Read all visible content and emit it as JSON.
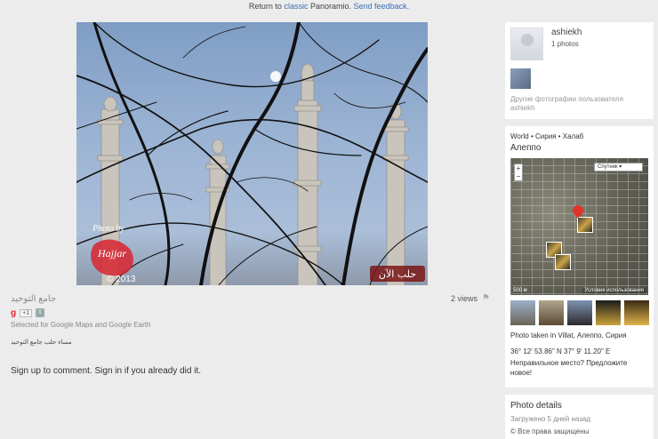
{
  "topbar": {
    "prefix": "Return to",
    "classic_link": "classic",
    "middle": "Panoramio.",
    "feedback_link": "Send feedback."
  },
  "photo": {
    "watermark_line1": "Photo by",
    "watermark_line2": "Hajjar",
    "watermark_year": "© 2013",
    "overlay_text": "حلب الآن"
  },
  "photo_title": "جامع التوحيد",
  "views": "2 views",
  "selected_text": "Selected for Google Maps and Google Earth",
  "description": "مساء حلب جامع التوحيد",
  "signup_text": "Sign up to comment. Sign in if you already did it.",
  "user": {
    "name": "ashiekh",
    "photo_count": "1 photos",
    "other_photos_line1": "Другие фотографии пользователя",
    "other_photos_line2": "ashiekh"
  },
  "location": {
    "breadcrumb": "World • Сирия • Халаб",
    "city": "Алеппо",
    "map_type": "Спутник",
    "map_scale": "500 м",
    "map_terms": "Условия использования",
    "map_zoom_in": "+",
    "map_zoom_out": "−",
    "taken_in": "Photo taken in Villat, Алеппо, Сирия",
    "coords": "36° 12' 53.86\" N  37° 9' 11.20\" E",
    "wrong_place": "Неправильное место? Предложите новое!"
  },
  "details": {
    "heading": "Photo details",
    "uploaded": "Загружено 5 дней назад",
    "rights": "© Все права защищены"
  },
  "colors": {
    "accent": "#3a6fb6",
    "page_bg": "#ececec"
  }
}
